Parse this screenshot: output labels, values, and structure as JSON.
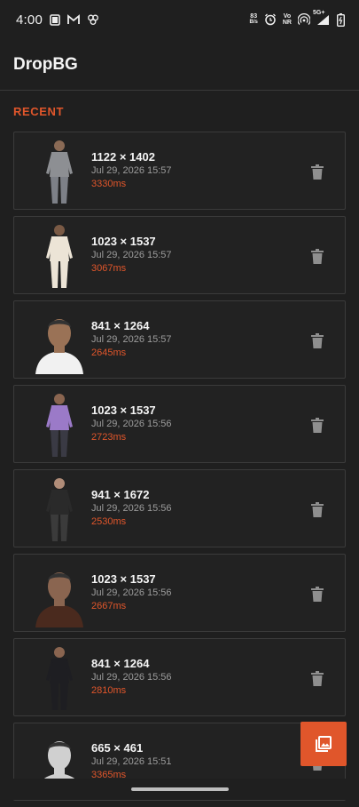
{
  "status_bar": {
    "time": "4:00",
    "speed_value": "83",
    "speed_unit": "B/s",
    "volte_top": "Vo",
    "volte_bottom": "NR",
    "network": "5G+"
  },
  "app": {
    "title": "DropBG"
  },
  "section": {
    "label": "RECENT"
  },
  "items": [
    {
      "dims": "1122 × 1402",
      "date": "Jul 29, 2026  15:57",
      "ms": "3330ms",
      "shirt": "#8d8f93",
      "pants": "#7d8087",
      "skin": "#8a6a55",
      "pose": "standing-suit"
    },
    {
      "dims": "1023 × 1537",
      "date": "Jul 29, 2026  15:57",
      "ms": "3067ms",
      "shirt": "#ece4d6",
      "pants": "#ece4d6",
      "skin": "#7a5a45",
      "pose": "standing-white"
    },
    {
      "dims": "841 × 1264",
      "date": "Jul 29, 2026  15:57",
      "ms": "2645ms",
      "shirt": "#f1f1f1",
      "pants": "#f1f1f1",
      "skin": "#9a7256",
      "pose": "portrait"
    },
    {
      "dims": "1023 × 1537",
      "date": "Jul 29, 2026  15:56",
      "ms": "2723ms",
      "shirt": "#9b7ac8",
      "pants": "#3a3a44",
      "skin": "#8a6550",
      "pose": "standing-purple"
    },
    {
      "dims": "941 × 1672",
      "date": "Jul 29, 2026  15:56",
      "ms": "2530ms",
      "shirt": "#2a2a2a",
      "pants": "#3b3b3b",
      "skin": "#b08c78",
      "pose": "seated"
    },
    {
      "dims": "1023 × 1537",
      "date": "Jul 29, 2026  15:56",
      "ms": "2667ms",
      "shirt": "#4a2a1e",
      "pants": "#2a1a14",
      "skin": "#8a6550",
      "pose": "portrait-brown"
    },
    {
      "dims": "841 × 1264",
      "date": "Jul 29, 2026  15:56",
      "ms": "2810ms",
      "shirt": "#1e1e22",
      "pants": "#1e1e22",
      "skin": "#8a6550",
      "pose": "standing-black"
    },
    {
      "dims": "665 × 461",
      "date": "Jul 29, 2026  15:51",
      "ms": "3365ms",
      "shirt": "#cfcfcf",
      "pants": "#cfcfcf",
      "skin": "#d0d0d0",
      "pose": "bw-portrait"
    }
  ],
  "colors": {
    "accent": "#e0562b",
    "background": "#1f1f1f",
    "card_border": "#3b3b3b"
  },
  "icons": {
    "delete": "trash-icon",
    "fab": "photo-library-icon"
  }
}
